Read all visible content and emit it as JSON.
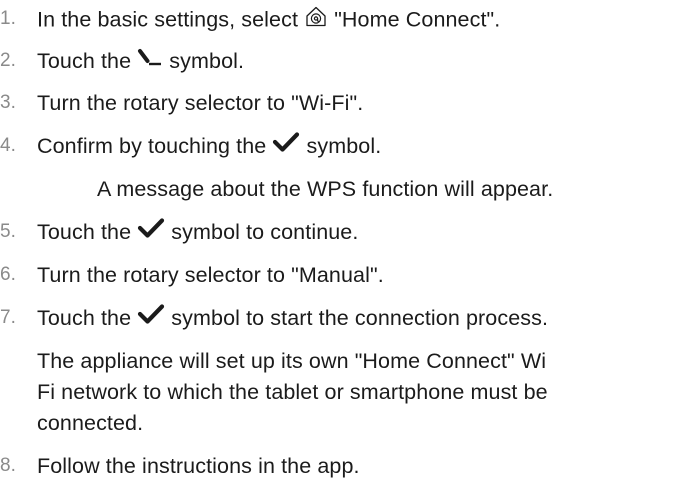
{
  "steps": [
    {
      "number": "1.",
      "before": "In the basic settings, select",
      "icon": "home-connect-icon",
      "after": "\"Home Connect\"."
    },
    {
      "number": "2.",
      "before": "Touch the",
      "icon": "remote-start-icon",
      "after": "symbol."
    },
    {
      "number": "3.",
      "text": "Turn the rotary selector to \"Wi-Fi\"."
    },
    {
      "number": "4.",
      "before": "Confirm by touching the",
      "icon": "checkmark-icon",
      "after": "symbol."
    },
    {
      "number": "5.",
      "before": "Touch the",
      "icon": "checkmark-icon",
      "after": "symbol to continue."
    },
    {
      "number": "6.",
      "text": "Turn the rotary selector to \"Manual\"."
    },
    {
      "number": "7.",
      "before": "Touch the",
      "icon": "checkmark-icon",
      "after": "symbol to start the connection process."
    },
    {
      "number": "8.",
      "text": "Follow the instructions in the app."
    }
  ],
  "step4_result": "A message about the WPS function will appear.",
  "step7_note_lines": [
    "The appliance will set up its own \"Home Connect\" Wi",
    "Fi network to which the tablet or smartphone must be",
    "connected."
  ],
  "colors": {
    "text": "#1b1b1b",
    "step_number": "#8a8a8a"
  }
}
